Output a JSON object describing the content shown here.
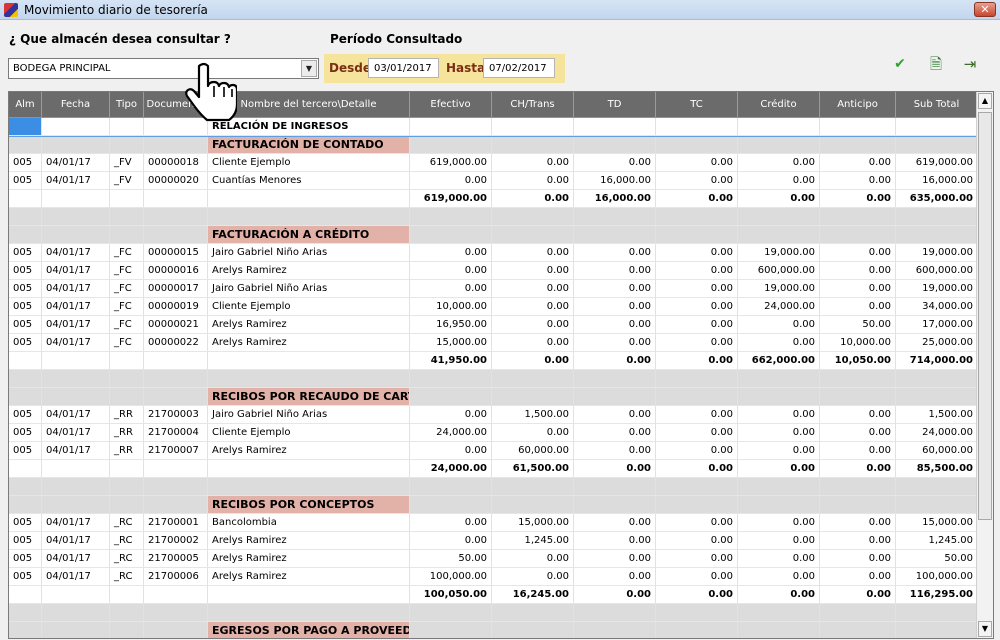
{
  "window": {
    "title": "Movimiento diario de tesorería",
    "close": "✕"
  },
  "query": {
    "label": "¿ Que almacén desea consultar ?",
    "store_value": "BODEGA PRINCIPAL"
  },
  "period": {
    "label": "Período Consultado",
    "desde_label": "Desde",
    "desde": "03/01/2017",
    "hasta_label": "Hasta",
    "hasta": "07/02/2017"
  },
  "toolbar": {
    "ok_icon": "✔",
    "export_icon": "🗎",
    "exit_icon": "⇥"
  },
  "columns": [
    "Alm",
    "Fecha",
    "Tipo",
    "Documento",
    "Nombre del tercero\\Detalle",
    "Efectivo",
    "CH/Trans",
    "TD",
    "TC",
    "Crédito",
    "Anticipo",
    "Sub Total"
  ],
  "rows": [
    {
      "kind": "title",
      "c": [
        "",
        "",
        "",
        "",
        "RELACIÓN DE INGRESOS",
        "",
        "",
        "",
        "",
        "",
        "",
        ""
      ]
    },
    {
      "kind": "section",
      "c": [
        "",
        "",
        "",
        "",
        "FACTURACIÓN DE CONTADO",
        "",
        "",
        "",
        "",
        "",
        "",
        ""
      ]
    },
    {
      "kind": "data",
      "c": [
        "005",
        "04/01/17",
        "_FV",
        "00000018",
        "Cliente Ejemplo",
        "619,000.00",
        "0.00",
        "0.00",
        "0.00",
        "0.00",
        "0.00",
        "619,000.00"
      ]
    },
    {
      "kind": "data",
      "c": [
        "005",
        "04/01/17",
        "_FV",
        "00000020",
        "Cuantías Menores",
        "0.00",
        "0.00",
        "16,000.00",
        "0.00",
        "0.00",
        "0.00",
        "16,000.00"
      ]
    },
    {
      "kind": "total",
      "c": [
        "",
        "",
        "",
        "",
        "",
        "619,000.00",
        "0.00",
        "16,000.00",
        "0.00",
        "0.00",
        "0.00",
        "635,000.00"
      ]
    },
    {
      "kind": "blank",
      "c": [
        "",
        "",
        "",
        "",
        "",
        "",
        "",
        "",
        "",
        "",
        "",
        ""
      ]
    },
    {
      "kind": "section",
      "c": [
        "",
        "",
        "",
        "",
        "FACTURACIÓN A CRÉDITO",
        "",
        "",
        "",
        "",
        "",
        "",
        ""
      ]
    },
    {
      "kind": "data",
      "c": [
        "005",
        "04/01/17",
        "_FC",
        "00000015",
        "Jairo Gabriel Niño Arias",
        "0.00",
        "0.00",
        "0.00",
        "0.00",
        "19,000.00",
        "0.00",
        "19,000.00"
      ]
    },
    {
      "kind": "data",
      "c": [
        "005",
        "04/01/17",
        "_FC",
        "00000016",
        "Arelys Ramirez",
        "0.00",
        "0.00",
        "0.00",
        "0.00",
        "600,000.00",
        "0.00",
        "600,000.00"
      ]
    },
    {
      "kind": "data",
      "c": [
        "005",
        "04/01/17",
        "_FC",
        "00000017",
        "Jairo Gabriel Niño Arias",
        "0.00",
        "0.00",
        "0.00",
        "0.00",
        "19,000.00",
        "0.00",
        "19,000.00"
      ]
    },
    {
      "kind": "data",
      "c": [
        "005",
        "04/01/17",
        "_FC",
        "00000019",
        "Cliente Ejemplo",
        "10,000.00",
        "0.00",
        "0.00",
        "0.00",
        "24,000.00",
        "0.00",
        "34,000.00"
      ]
    },
    {
      "kind": "data",
      "c": [
        "005",
        "04/01/17",
        "_FC",
        "00000021",
        "Arelys Ramirez",
        "16,950.00",
        "0.00",
        "0.00",
        "0.00",
        "0.00",
        "50.00",
        "17,000.00"
      ]
    },
    {
      "kind": "data",
      "c": [
        "005",
        "04/01/17",
        "_FC",
        "00000022",
        "Arelys Ramirez",
        "15,000.00",
        "0.00",
        "0.00",
        "0.00",
        "0.00",
        "10,000.00",
        "25,000.00"
      ]
    },
    {
      "kind": "total",
      "c": [
        "",
        "",
        "",
        "",
        "",
        "41,950.00",
        "0.00",
        "0.00",
        "0.00",
        "662,000.00",
        "10,050.00",
        "714,000.00"
      ]
    },
    {
      "kind": "blank",
      "c": [
        "",
        "",
        "",
        "",
        "",
        "",
        "",
        "",
        "",
        "",
        "",
        ""
      ]
    },
    {
      "kind": "section",
      "c": [
        "",
        "",
        "",
        "",
        "RECIBOS POR RECAUDO DE CARTE",
        "",
        "",
        "",
        "",
        "",
        "",
        ""
      ]
    },
    {
      "kind": "data",
      "c": [
        "005",
        "04/01/17",
        "_RR",
        "21700003",
        "Jairo Gabriel Niño Arias",
        "0.00",
        "1,500.00",
        "0.00",
        "0.00",
        "0.00",
        "0.00",
        "1,500.00"
      ]
    },
    {
      "kind": "data",
      "c": [
        "005",
        "04/01/17",
        "_RR",
        "21700004",
        "Cliente Ejemplo",
        "24,000.00",
        "0.00",
        "0.00",
        "0.00",
        "0.00",
        "0.00",
        "24,000.00"
      ]
    },
    {
      "kind": "data",
      "c": [
        "005",
        "04/01/17",
        "_RR",
        "21700007",
        "Arelys Ramirez",
        "0.00",
        "60,000.00",
        "0.00",
        "0.00",
        "0.00",
        "0.00",
        "60,000.00"
      ]
    },
    {
      "kind": "total",
      "c": [
        "",
        "",
        "",
        "",
        "",
        "24,000.00",
        "61,500.00",
        "0.00",
        "0.00",
        "0.00",
        "0.00",
        "85,500.00"
      ]
    },
    {
      "kind": "blank",
      "c": [
        "",
        "",
        "",
        "",
        "",
        "",
        "",
        "",
        "",
        "",
        "",
        ""
      ]
    },
    {
      "kind": "section",
      "c": [
        "",
        "",
        "",
        "",
        "RECIBOS POR CONCEPTOS",
        "",
        "",
        "",
        "",
        "",
        "",
        ""
      ]
    },
    {
      "kind": "data",
      "c": [
        "005",
        "04/01/17",
        "_RC",
        "21700001",
        "Bancolombia",
        "0.00",
        "15,000.00",
        "0.00",
        "0.00",
        "0.00",
        "0.00",
        "15,000.00"
      ]
    },
    {
      "kind": "data",
      "c": [
        "005",
        "04/01/17",
        "_RC",
        "21700002",
        "Arelys Ramirez",
        "0.00",
        "1,245.00",
        "0.00",
        "0.00",
        "0.00",
        "0.00",
        "1,245.00"
      ]
    },
    {
      "kind": "data",
      "c": [
        "005",
        "04/01/17",
        "_RC",
        "21700005",
        "Arelys Ramirez",
        "50.00",
        "0.00",
        "0.00",
        "0.00",
        "0.00",
        "0.00",
        "50.00"
      ]
    },
    {
      "kind": "data",
      "c": [
        "005",
        "04/01/17",
        "_RC",
        "21700006",
        "Arelys Ramirez",
        "100,000.00",
        "0.00",
        "0.00",
        "0.00",
        "0.00",
        "0.00",
        "100,000.00"
      ]
    },
    {
      "kind": "total",
      "c": [
        "",
        "",
        "",
        "",
        "",
        "100,050.00",
        "16,245.00",
        "0.00",
        "0.00",
        "0.00",
        "0.00",
        "116,295.00"
      ]
    },
    {
      "kind": "blank",
      "c": [
        "",
        "",
        "",
        "",
        "",
        "",
        "",
        "",
        "",
        "",
        "",
        ""
      ]
    },
    {
      "kind": "section",
      "c": [
        "",
        "",
        "",
        "",
        "EGRESOS POR PAGO A PROVEEDO",
        "",
        "",
        "",
        "",
        "",
        "",
        ""
      ]
    }
  ]
}
